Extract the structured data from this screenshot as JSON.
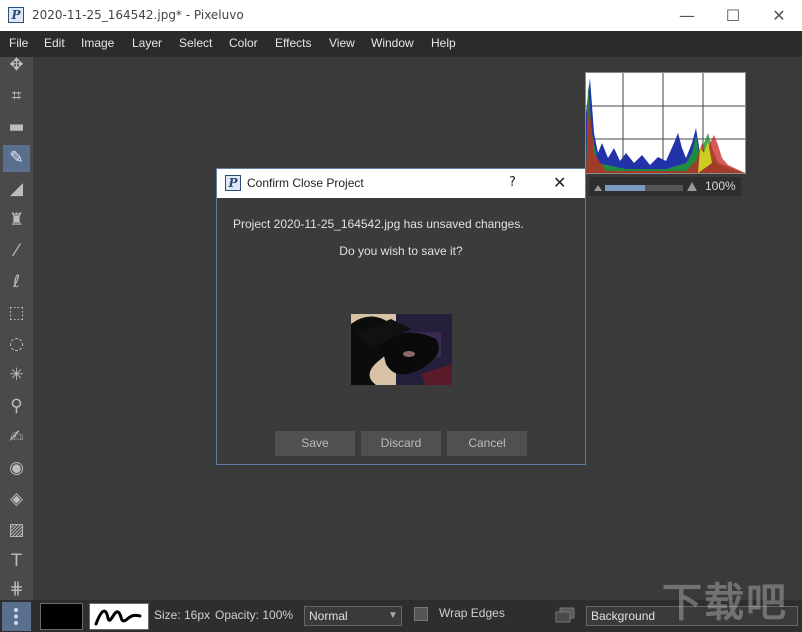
{
  "window": {
    "title": "2020-11-25_164542.jpg* - Pixeluvo",
    "app_glyph": "P",
    "minimize": "—",
    "maximize": "☐",
    "close": "✕"
  },
  "menu": [
    "File",
    "Edit",
    "Image",
    "Layer",
    "Select",
    "Color",
    "Effects",
    "View",
    "Window",
    "Help"
  ],
  "tools": [
    {
      "name": "move-icon",
      "glyph": "✥"
    },
    {
      "name": "crop-icon",
      "glyph": "⌗"
    },
    {
      "name": "straighten-icon",
      "glyph": "▬"
    },
    {
      "name": "brush-icon",
      "glyph": "✎",
      "active": true
    },
    {
      "name": "eraser-icon",
      "glyph": "◢"
    },
    {
      "name": "clone-stamp-icon",
      "glyph": "♜"
    },
    {
      "name": "pencil-icon",
      "glyph": "⁄"
    },
    {
      "name": "lasso-icon",
      "glyph": "ℓ"
    },
    {
      "name": "rect-select-icon",
      "glyph": "⬚"
    },
    {
      "name": "ellipse-select-icon",
      "glyph": "◌"
    },
    {
      "name": "magic-wand-icon",
      "glyph": "✳"
    },
    {
      "name": "smudge-icon",
      "glyph": "⚲"
    },
    {
      "name": "dodge-burn-icon",
      "glyph": "✍"
    },
    {
      "name": "red-eye-icon",
      "glyph": "◉"
    },
    {
      "name": "fill-bucket-icon",
      "glyph": "◈"
    },
    {
      "name": "gradient-icon",
      "glyph": "▨"
    },
    {
      "name": "text-icon",
      "glyph": "T"
    },
    {
      "name": "shape-icon",
      "glyph": "⋕"
    }
  ],
  "histogram": {
    "zoom": "100%"
  },
  "dialog": {
    "title": "Confirm Close Project",
    "help": "?",
    "close": "✕",
    "message": "Project 2020-11-25_164542.jpg has unsaved changes.",
    "question": "Do you wish to save it?",
    "buttons": {
      "save": "Save",
      "discard": "Discard",
      "cancel": "Cancel"
    }
  },
  "options": {
    "size_label": "Size: 16px",
    "opacity_label": "Opacity: 100%",
    "blend_mode": "Normal",
    "wrap_edges": "Wrap Edges",
    "layer": "Background",
    "dropdown_arrow": "▼"
  },
  "watermark": "下载吧",
  "colors": {
    "canvas": "#3a3a3a",
    "toolbox": "#4a4a4a",
    "accent": "#5a6f8e",
    "button": "#505050"
  }
}
